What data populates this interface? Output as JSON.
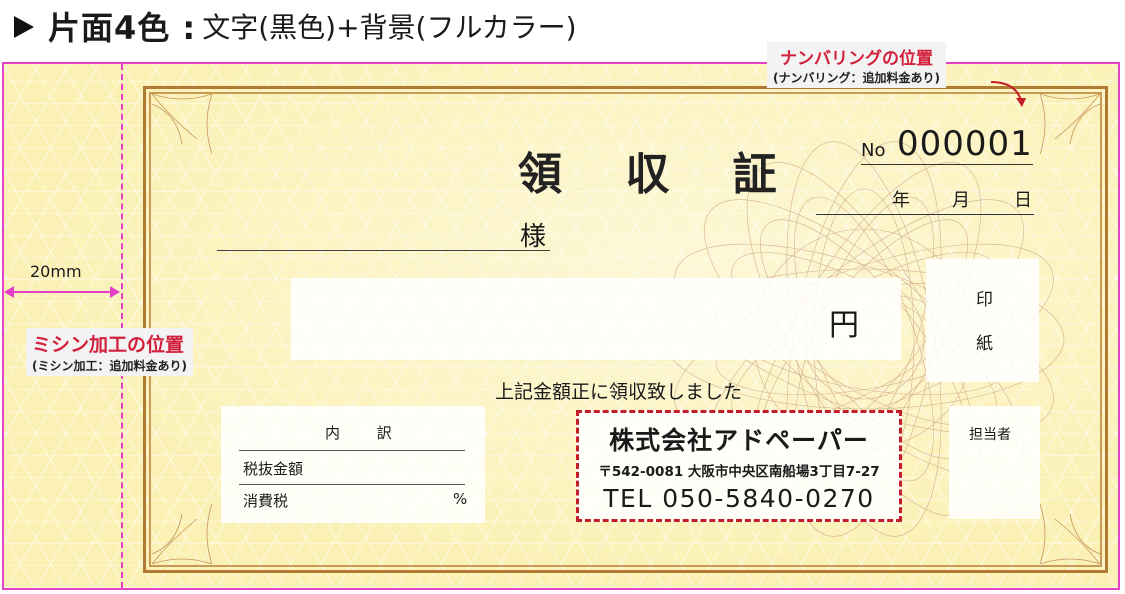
{
  "header": {
    "title": "片面4色 :",
    "subtitle": "文字(黒色)+背景(フルカラー)"
  },
  "numbering": {
    "title": "ナンバリングの位置",
    "note": "(ナンバリング：追加料金あり)"
  },
  "perforation": {
    "title": "ミシン加工の位置",
    "note": "(ミシン加工：追加料金あり)",
    "width_label": "20mm"
  },
  "receipt": {
    "title": "領 収 証",
    "no_label": "No",
    "no_value": "000001",
    "year": "年",
    "month": "月",
    "day": "日",
    "addressee_suffix": "様",
    "yen": "円",
    "stamp_top": "印",
    "stamp_bottom": "紙",
    "received_text": "上記金額正に領収致しました",
    "breakdown_header": "内 訳",
    "breakdown_row1": "税抜金額",
    "breakdown_row2": "消費税",
    "breakdown_pct": "%",
    "staff_label": "担当者"
  },
  "company": {
    "name": "株式会社アドペーパー",
    "address": "〒542-0081 大阪市中央区南船場3丁目7-27",
    "tel": "TEL 050-5840-0270"
  },
  "colors": {
    "accent_red": "#d2203c",
    "guide_magenta": "#e641c8",
    "frame_brown": "#b07a35",
    "background_gold": "#fbf1b5"
  }
}
